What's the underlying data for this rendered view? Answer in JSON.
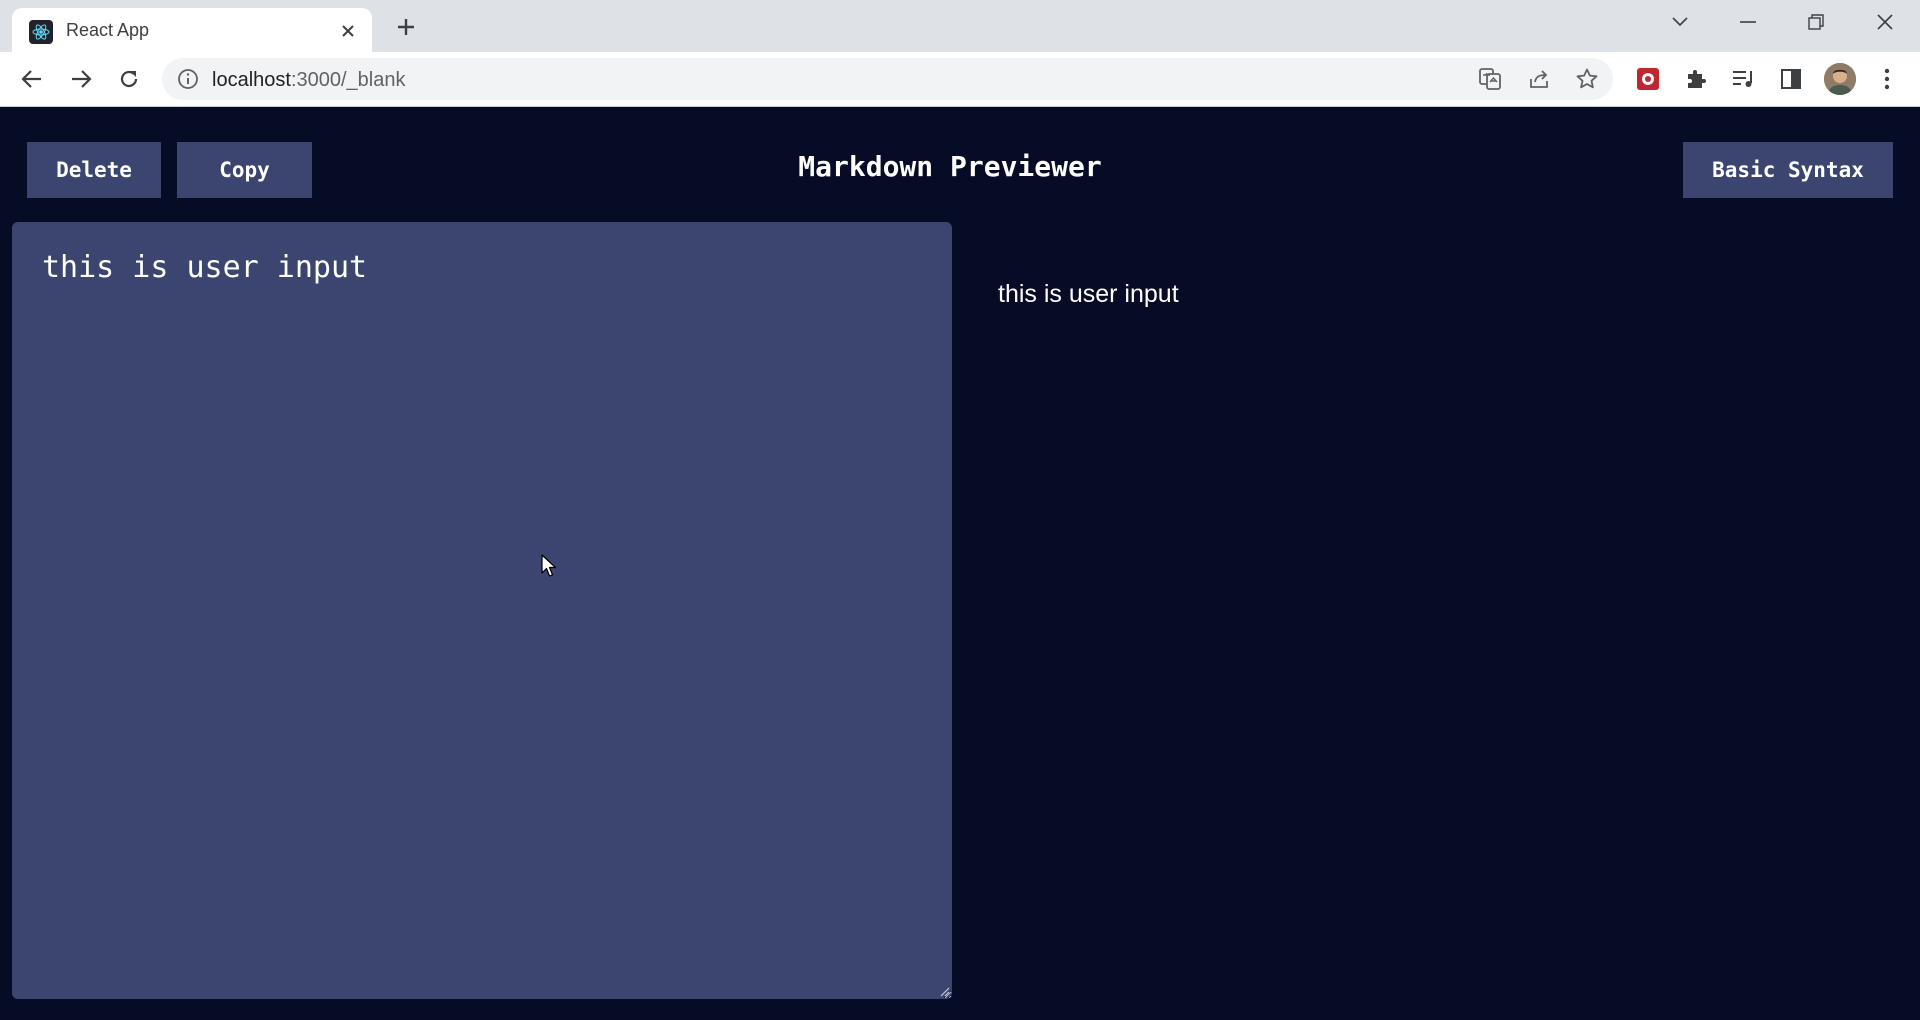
{
  "browser": {
    "tab_title": "React App",
    "url_host": "localhost",
    "url_path": ":3000/_blank",
    "icons": [
      "react-favicon-icon",
      "close-icon",
      "plus-icon",
      "chevron-down-icon",
      "minimize-icon",
      "restore-icon",
      "window-close-icon",
      "back-arrow-icon",
      "forward-arrow-icon",
      "reload-icon",
      "info-icon",
      "translate-icon",
      "share-icon",
      "star-icon",
      "extension-red-icon",
      "puzzle-icon",
      "media-control-icon",
      "side-panel-icon",
      "profile-avatar",
      "kebab-menu-icon"
    ]
  },
  "app": {
    "delete_label": "Delete",
    "copy_label": "Copy",
    "title": "Markdown Previewer",
    "syntax_label": "Basic Syntax",
    "editor_text": "this is user input",
    "preview_text": "this is user input",
    "colors": {
      "background": "#060b26",
      "panel": "#3b4570",
      "text": "#ffffff"
    }
  }
}
